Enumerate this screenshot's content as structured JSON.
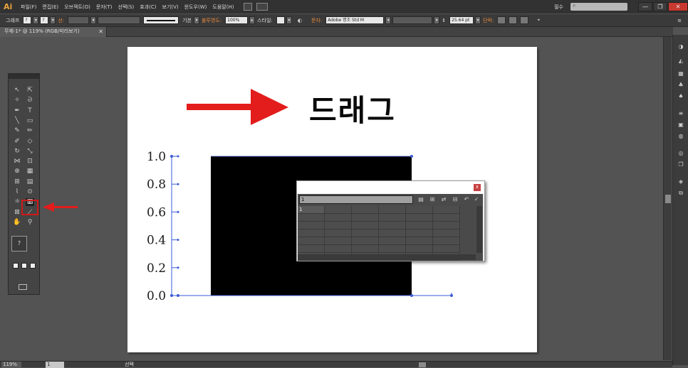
{
  "app": {
    "logo": "Ai",
    "menu": [
      "파일(F)",
      "편집(E)",
      "오브젝트(O)",
      "문자(T)",
      "선택(S)",
      "효과(C)",
      "보기(V)",
      "윈도우(W)",
      "도움말(H)"
    ],
    "workspace": "필수",
    "window_controls": [
      "—",
      "❐",
      "✕"
    ]
  },
  "control_bar": {
    "selection_label": "그래프",
    "stroke_label": "선:",
    "stroke_style": "기본",
    "opacity_label": "불투명도:",
    "opacity_value": "100%",
    "style_label": "스타일:",
    "char_label": "문자:",
    "font_name": "Adobe 명조 Std M",
    "font_size": "25.64 pt",
    "paragraph_label": "단락:"
  },
  "document": {
    "tab_title": "무제-1* @ 119% (RGB/미리보기)",
    "tab_close": "✕"
  },
  "canvas": {
    "drag_label": "드래그",
    "colors": {
      "arrow": "#e31c1c",
      "rect": "#000000",
      "axis": "#3a5bd8"
    }
  },
  "chart_data": {
    "type": "bar",
    "categories": [
      "1"
    ],
    "values": [
      1.0
    ],
    "ylim": [
      0.0,
      1.0
    ],
    "yticks": [
      "1.0",
      "0.8",
      "0.6",
      "0.4",
      "0.2",
      "0.0"
    ],
    "grid": false
  },
  "data_window": {
    "entry_value": "1",
    "first_cell": "1",
    "rows": 7,
    "cols": 6,
    "close": "x",
    "toolbar_icons": [
      "import-data-icon",
      "transpose-icon",
      "switch-xy-icon",
      "cell-style-icon",
      "revert-icon",
      "apply-icon"
    ]
  },
  "status_bar": {
    "zoom": "119%",
    "page": "1",
    "status_text": "선택"
  },
  "tools_panel": {
    "active_tool": "column-graph-tool"
  }
}
